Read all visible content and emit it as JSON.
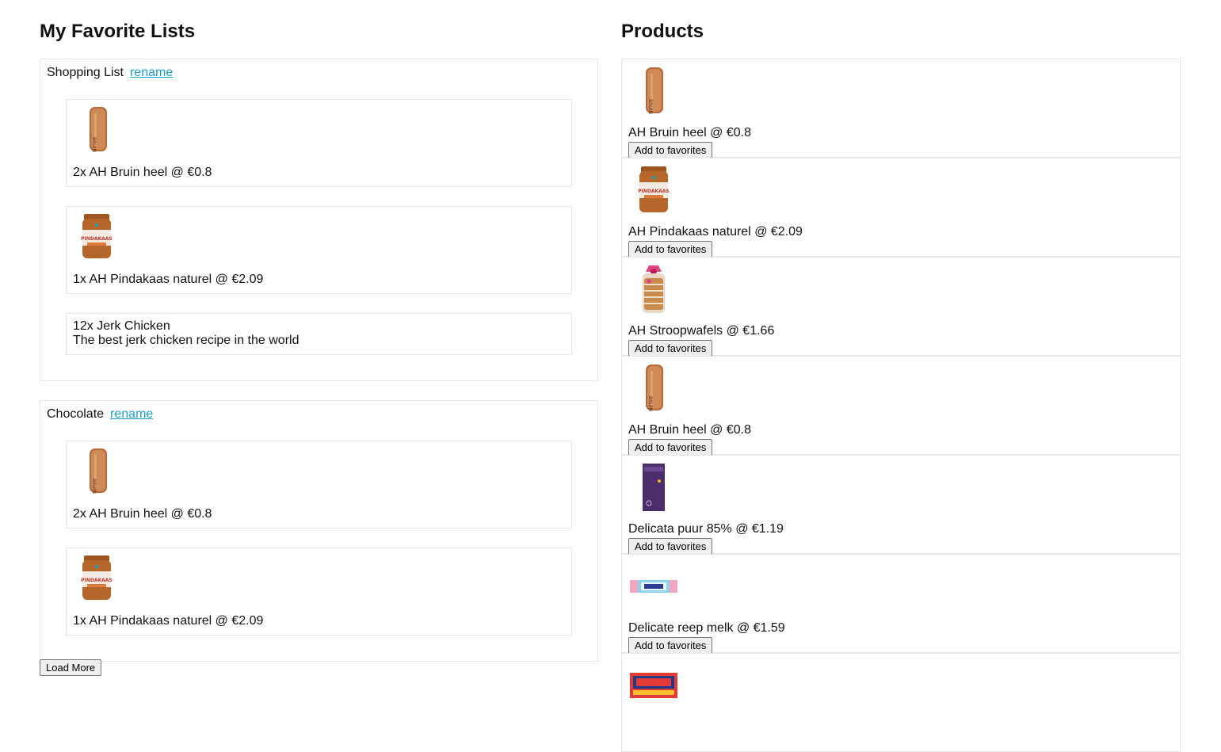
{
  "favorites": {
    "title": "My Favorite Lists",
    "rename_label": "rename",
    "lists": [
      {
        "name": "Shopping List",
        "entries": [
          {
            "text": "2x AH Bruin heel @ €0.8",
            "icon": "bread-icon"
          },
          {
            "text": "1x AH Pindakaas naturel @ €2.09",
            "icon": "peanut-butter-icon"
          },
          {
            "text": "12x Jerk Chicken",
            "subtext": "The best jerk chicken recipe in the world"
          }
        ]
      },
      {
        "name": "Chocolate",
        "entries": [
          {
            "text": "2x AH Bruin heel @ €0.8",
            "icon": "bread-icon"
          },
          {
            "text": "1x AH Pindakaas naturel @ €2.09",
            "icon": "peanut-butter-icon"
          }
        ]
      }
    ],
    "load_more_label": "Load More"
  },
  "products": {
    "title": "Products",
    "add_label": "Add to favorites",
    "items": [
      {
        "text": "AH Bruin heel @ €0.8",
        "icon": "bread-icon"
      },
      {
        "text": "AH Pindakaas naturel @ €2.09",
        "icon": "peanut-butter-icon"
      },
      {
        "text": "AH Stroopwafels @ €1.66",
        "icon": "stroopwafels-icon"
      },
      {
        "text": "AH Bruin heel @ €0.8",
        "icon": "bread-icon"
      },
      {
        "text": "Delicata puur 85% @ €1.19",
        "icon": "dark-chocolate-bar-icon"
      },
      {
        "text": "Delicate reep melk @ €1.59",
        "icon": "milk-chocolate-bar-icon"
      },
      {
        "text": "",
        "icon": "tonys-chocolate-bar-icon"
      }
    ]
  }
}
